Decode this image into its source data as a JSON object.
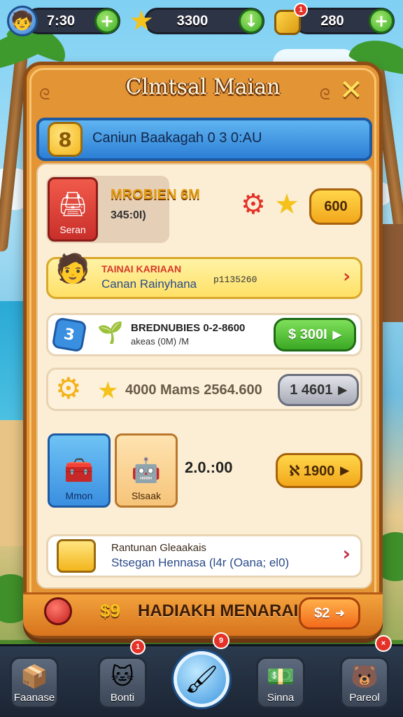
{
  "hud": {
    "time": "7:30",
    "stars": "3300",
    "gold": "280",
    "gold_badge": "1",
    "plus_symbol": "+",
    "arrow_symbol": "↓"
  },
  "panel": {
    "title": "Clmtsal Maian",
    "banner_text": "Caniun Baakagah 0 3 0:AU",
    "banner_coin": "8"
  },
  "rows": {
    "row1": {
      "tile_label": "Seran",
      "title": "MROBIEN 6M",
      "subtitle": "345:0I)",
      "button": "600"
    },
    "row2": {
      "title": "TAINAI KARIAAN",
      "subtitle": "Canan Rainyhana",
      "extra": "p1135260"
    },
    "row3": {
      "badge": "3",
      "title": "BREDNUBIES 0-2-8600",
      "subtitle": "akeas (0M) /M",
      "button": "$ 300I"
    },
    "row4": {
      "text": "4000 Mams 2564.600",
      "button": "1 4601"
    },
    "row5": {
      "tile1_label": "Mmon",
      "tile2_label": "Slsaak",
      "value": "2.0.:00",
      "button": "ℵ 1900"
    },
    "row6": {
      "title": "Rantunan Gleaakais",
      "subtitle": "Stsegan Hennasa (l4r (Oana; el0)"
    }
  },
  "bottom": {
    "text": "HADIAKH MENARAIK",
    "prefix": "$9",
    "button": "$2"
  },
  "nav": {
    "items": [
      {
        "label": "Faanase"
      },
      {
        "label": "Bonti",
        "badge": "1"
      },
      {
        "label": "",
        "badge": "9"
      },
      {
        "label": "Sinna"
      },
      {
        "label": "Pareol",
        "badge": "×"
      }
    ]
  },
  "colors": {
    "panel": "#e39536",
    "banner": "#2d7fd6",
    "green_button": "#46b829",
    "orange_button": "#f5a623",
    "gray_button": "#b9bcc7"
  }
}
